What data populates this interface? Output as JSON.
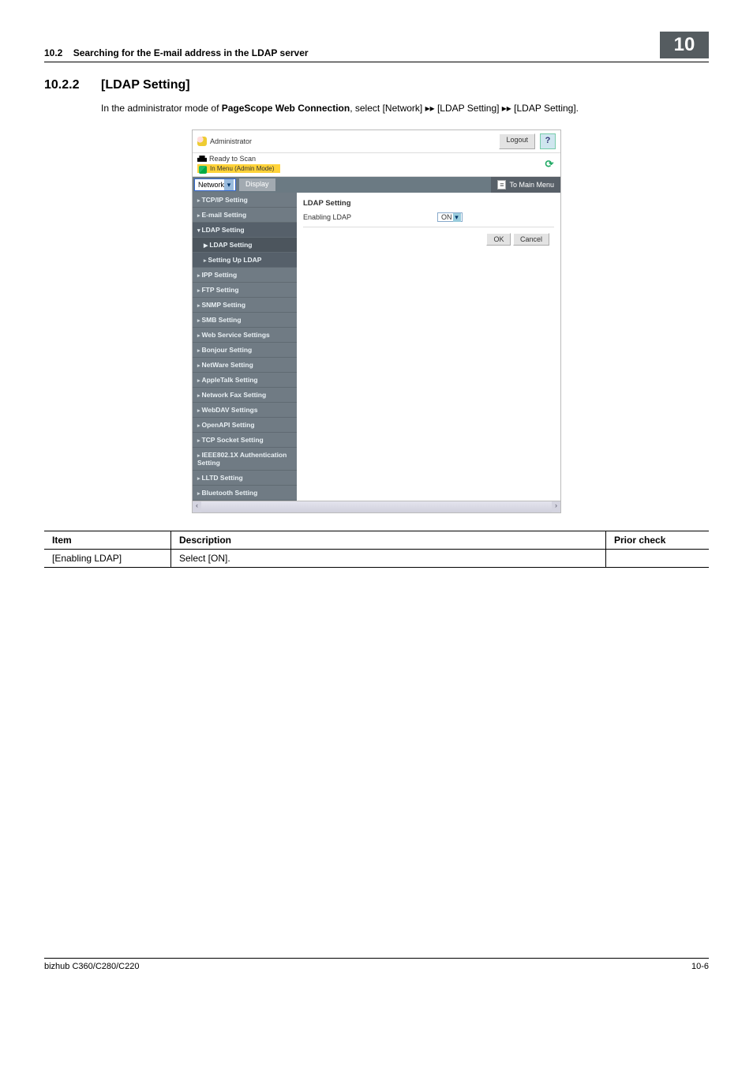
{
  "header": {
    "section_no": "10.2",
    "section_title": "Searching for the E-mail address in the LDAP server",
    "chapter_no": "10"
  },
  "section": {
    "number": "10.2.2",
    "title": "[LDAP Setting]"
  },
  "intro_parts": {
    "p1": "In the administrator mode of ",
    "bold": "PageScope Web Connection",
    "p2": ", select [Network] ▸▸ [LDAP Setting] ▸▸ [LDAP Setting]."
  },
  "ws": {
    "admin_label": "Administrator",
    "logout": "Logout",
    "help": "?",
    "ready": "Ready to Scan",
    "menu_banner": "In Menu (Admin Mode)",
    "refresh": "⟳",
    "nav_select": "Network",
    "display_btn": "Display",
    "to_main_menu": "To Main Menu",
    "side": {
      "tcpip": "TCP/IP Setting",
      "email": "E-mail Setting",
      "ldap_group": "LDAP Setting",
      "ldap_sub1": "LDAP Setting",
      "ldap_sub2": "Setting Up LDAP",
      "ipp": "IPP Setting",
      "ftp": "FTP Setting",
      "snmp": "SNMP Setting",
      "smb": "SMB Setting",
      "wss": "Web Service Settings",
      "bonjour": "Bonjour Setting",
      "netware": "NetWare Setting",
      "appletalk": "AppleTalk Setting",
      "netfax": "Network Fax Setting",
      "webdav": "WebDAV Settings",
      "openapi": "OpenAPI Setting",
      "tcpsock": "TCP Socket Setting",
      "ieee": "IEEE802.1X Authentication Setting",
      "lltd": "LLTD Setting",
      "bt": "Bluetooth Setting"
    },
    "main": {
      "heading": "LDAP Setting",
      "field_label": "Enabling LDAP",
      "field_value": "ON",
      "ok": "OK",
      "cancel": "Cancel"
    }
  },
  "table": {
    "h_item": "Item",
    "h_desc": "Description",
    "h_prior": "Prior check",
    "r1_item": "[Enabling LDAP]",
    "r1_desc": "Select [ON].",
    "r1_prior": ""
  },
  "footer": {
    "model": "bizhub C360/C280/C220",
    "page": "10-6"
  }
}
